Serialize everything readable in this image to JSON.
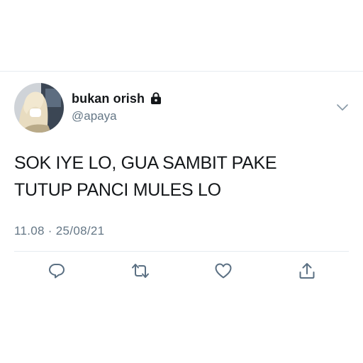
{
  "tweet": {
    "display_name": "bukan orish",
    "handle": "@apaya",
    "text_lines": [
      "SOK IYE LO, GUA SAMBIT PAKE",
      "TUTUP PANCI MULES LO"
    ],
    "timestamp": "11.08 · 25/08/21"
  },
  "icons": {
    "protected": "lock-icon",
    "more": "chevron-down-icon",
    "reply": "reply-icon",
    "retweet": "retweet-icon",
    "like": "heart-icon",
    "share": "share-icon"
  },
  "colors": {
    "text": "#14171a",
    "secondary": "#657786",
    "divider": "#e6ecf0",
    "icon": "#5b7083"
  }
}
